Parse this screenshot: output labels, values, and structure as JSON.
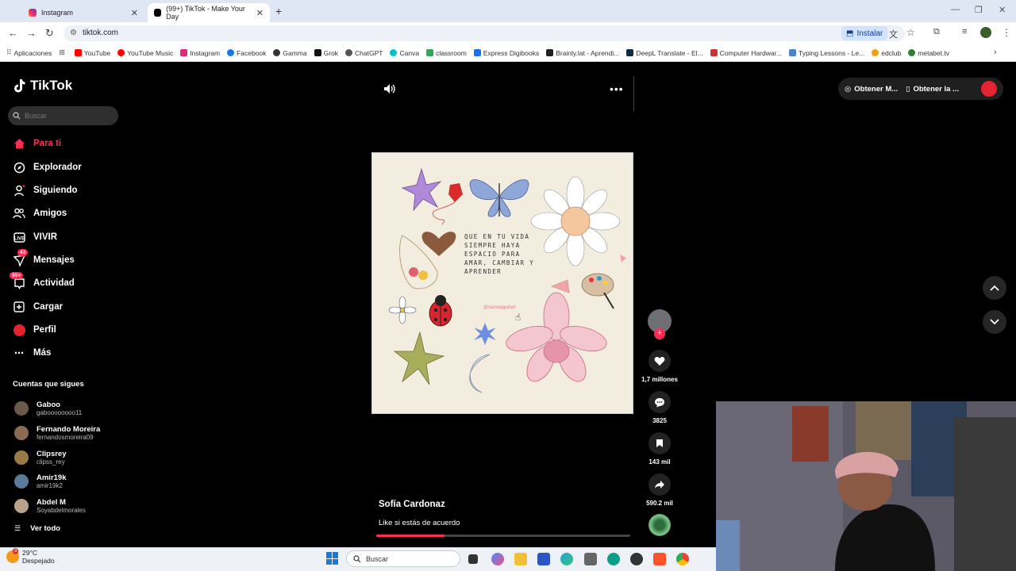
{
  "browser": {
    "tabs": [
      {
        "title": "Instagram",
        "active": false
      },
      {
        "title": "(99+) TikTok - Make Your Day",
        "active": true
      }
    ],
    "url": "tiktok.com",
    "install_label": "Instalar",
    "bookmarks": [
      "Aplicaciones",
      "YouTube",
      "YouTube Music",
      "Instagram",
      "Facebook",
      "Gamma",
      "Grok",
      "ChatGPT",
      "Canva",
      "classroom",
      "Express Digibooks",
      "Brainly.lat - Aprendi...",
      "DeepL Translate - El...",
      "Computer Hardwar...",
      "Typing Lessons - Le...",
      "edclub",
      "metabet.tv"
    ]
  },
  "sidebar": {
    "logo": "TikTok",
    "search_placeholder": "Buscar",
    "nav": [
      {
        "label": "Para ti",
        "active": true
      },
      {
        "label": "Explorador"
      },
      {
        "label": "Siguiendo"
      },
      {
        "label": "Amigos"
      },
      {
        "label": "VIVIR"
      },
      {
        "label": "Mensajes",
        "badge": "43"
      },
      {
        "label": "Actividad",
        "badge": "99+"
      },
      {
        "label": "Cargar"
      },
      {
        "label": "Perfil"
      },
      {
        "label": "Más"
      }
    ],
    "following_title": "Cuentas que sigues",
    "accounts": [
      {
        "name": "Gaboo",
        "handle": "gaboooooooo11"
      },
      {
        "name": "Fernando Moreira",
        "handle": "fernandosmoreira09"
      },
      {
        "name": "Clipsrey",
        "handle": "clipss_rey"
      },
      {
        "name": "Amir19k",
        "handle": "amir19k2"
      },
      {
        "name": "Abdel M",
        "handle": "Soyabdelmorales"
      }
    ],
    "see_all": "Ver todo"
  },
  "video": {
    "quote": "QUE EN TU VIDA SIEMPRE HAYA ESPACIO PARA AMAR, CAMBIAR Y APRENDER",
    "art_handle": "@samaaguilart",
    "creator": "Sofía Cardonaz",
    "caption": "Like si estás de acuerdo",
    "progress": 0.27
  },
  "actions": {
    "likes": "1,7 millones",
    "comments": "3825",
    "saves": "143 mil",
    "shares": "590.2 mil"
  },
  "topright": {
    "btn1": "Obtener M...",
    "btn2": "Obtener la ..."
  },
  "taskbar": {
    "temp": "29°C",
    "weather": "Despejado",
    "search": "Buscar",
    "notif": "3"
  },
  "colors": {
    "accent": "#fe2c55",
    "background": "#000000"
  }
}
